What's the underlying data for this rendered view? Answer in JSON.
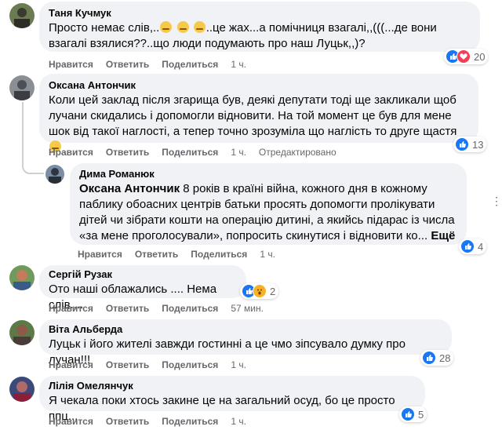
{
  "comments": [
    {
      "author": "Таня Кучмук",
      "text_a": "Просто немає слів,..",
      "text_b": "..це жах...а помічниця взагалі,,(((...де вони взагалі взялися??..що люди подумають про наш Луцьк,,)?",
      "like": "Нравится",
      "reply": "Ответить",
      "share": "Поделиться",
      "time": "1 ч.",
      "reactions": "20"
    },
    {
      "author": "Оксана Антончик",
      "text": "Коли цей заклад після згарища був, деякі депутати тоді ще закликали щоб лучани скидались і допомогли відновити. На той момент це був для мене шок від такої наглості, а тепер точно зрозуміла що наглість то друге щастя",
      "like": "Нравится",
      "reply": "Ответить",
      "share": "Поделиться",
      "time": "1 ч.",
      "edited": "Отредактировано",
      "reactions": "13"
    },
    {
      "author": "Дима Романюк",
      "mention": "Оксана Антончик",
      "text": " 8 років в країні війна, кожного дня в кожному паблику обоасних центрів батьки просять допомогти пролікувати дітей чи зібрати кошти на операцію дитині, а якийсь підарас із числа «за мене проголосували», попросить скинутися і відновити ко...",
      "more": "Ещё",
      "like": "Нравится",
      "reply": "Ответить",
      "share": "Поделиться",
      "time": "1 ч.",
      "reactions": "4"
    },
    {
      "author": "Сергій Рузак",
      "text": "Ото наші облажались .... Нема слів....",
      "like": "Нравится",
      "reply": "Ответить",
      "share": "Поделиться",
      "time": "57 мин.",
      "reactions": "2"
    },
    {
      "author": "Віта Альберда",
      "text": "Луцьк і його жителі завжди гостинні а це чмо зіпсувало думку про лучан!!!",
      "like": "Нравится",
      "reply": "Ответить",
      "share": "Поделиться",
      "time": "1 ч.",
      "reactions": "28"
    },
    {
      "author": "Лілія Омелянчук",
      "text": "Я чекала поки хтось закине це на загальний осуд, бо це просто ппц...",
      "like": "Нравится",
      "reply": "Ответить",
      "share": "Поделиться",
      "time": "1 ч.",
      "reactions": "5"
    }
  ],
  "icons": {
    "like": "like-icon",
    "love": "love-icon",
    "wow": "wow-icon",
    "more": "more-options-icon"
  },
  "colors": {
    "bubble": "#f0f2f5",
    "meta": "#65676b",
    "like": "#1877f2",
    "love": "#f33e58",
    "wow": "#f7b125"
  }
}
